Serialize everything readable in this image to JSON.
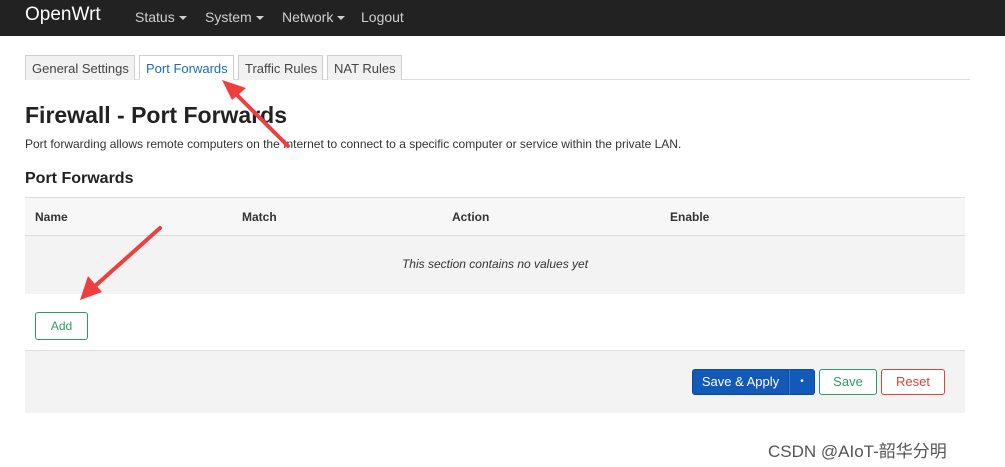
{
  "navbar": {
    "brand": "OpenWrt",
    "items": [
      {
        "label": "Status",
        "dropdown": true
      },
      {
        "label": "System",
        "dropdown": true
      },
      {
        "label": "Network",
        "dropdown": true
      },
      {
        "label": "Logout",
        "dropdown": false
      }
    ]
  },
  "tabs": [
    {
      "label": "General Settings",
      "active": false
    },
    {
      "label": "Port Forwards",
      "active": true
    },
    {
      "label": "Traffic Rules",
      "active": false
    },
    {
      "label": "NAT Rules",
      "active": false
    }
  ],
  "page": {
    "title": "Firewall - Port Forwards",
    "description": "Port forwarding allows remote computers on the Internet to connect to a specific computer or service within the private LAN."
  },
  "section": {
    "title": "Port Forwards",
    "columns": [
      "Name",
      "Match",
      "Action",
      "Enable"
    ],
    "empty_text": "This section contains no values yet",
    "add_label": "Add"
  },
  "footer": {
    "save_apply_label": "Save & Apply",
    "save_label": "Save",
    "reset_label": "Reset"
  },
  "watermark": "CSDN @AIoT-韶华分明",
  "colors": {
    "navbar_bg": "#222222",
    "active_tab": "#1a6fb5",
    "primary": "#1259b8",
    "positive": "#2e9b63",
    "negative": "#d9463b",
    "annotation_arrow": "#f03e3e"
  }
}
